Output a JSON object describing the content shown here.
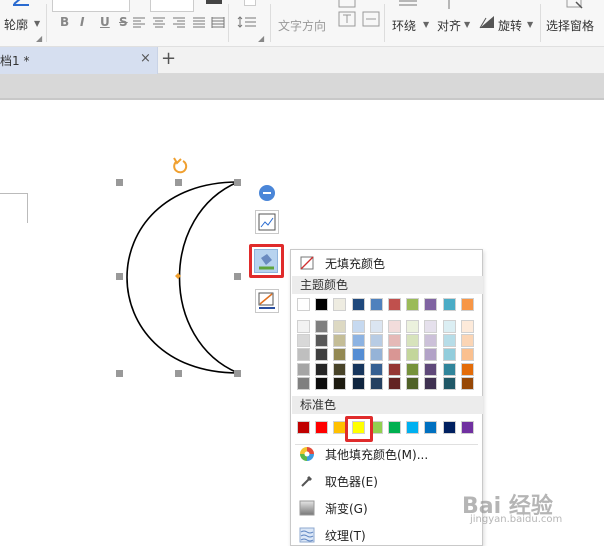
{
  "ribbon": {
    "outline_label": "轮廓",
    "text_direction_label": "文字方向",
    "wrap_label": "环绕",
    "align_label": "对齐",
    "rotate_label": "旋转",
    "selection_pane_label": "选择窗格",
    "bold": "B",
    "italic": "I",
    "underline": "U",
    "strike": "S"
  },
  "tabs": {
    "doc_tab_label": "档1 *",
    "close": "×",
    "add": "+"
  },
  "fill_menu": {
    "no_fill_label": "无填充颜色",
    "theme_colors_label": "主题颜色",
    "standard_colors_label": "标准色",
    "more_colors_label": "其他填充颜色(M)...",
    "eyedropper_label": "取色器(E)",
    "gradient_label": "渐变(G)",
    "texture_label": "纹理(T)",
    "theme_top_row": [
      "#ffffff",
      "#000000",
      "#eeece1",
      "#1f497d",
      "#4f81bd",
      "#c0504d",
      "#9bbb59",
      "#8064a2",
      "#4bacc6",
      "#f79646"
    ],
    "theme_shades": [
      [
        "#f2f2f2",
        "#7f7f7f",
        "#ddd9c3",
        "#c6d9f0",
        "#dbe5f1",
        "#f2dcdb",
        "#ebf1dd",
        "#e5e0ec",
        "#dbeef3",
        "#fdeada"
      ],
      [
        "#d8d8d8",
        "#595959",
        "#c4bd97",
        "#8db3e2",
        "#b8cce4",
        "#e5b9b7",
        "#d7e3bc",
        "#ccc1d9",
        "#b7dde8",
        "#fbd5b5"
      ],
      [
        "#bfbfbf",
        "#3f3f3f",
        "#938953",
        "#548dd4",
        "#95b3d7",
        "#d99694",
        "#c3d69b",
        "#b2a2c7",
        "#92cddc",
        "#fac08f"
      ],
      [
        "#a5a5a5",
        "#262626",
        "#494429",
        "#17365d",
        "#366092",
        "#953734",
        "#76923c",
        "#5f497a",
        "#31859b",
        "#e36c09"
      ],
      [
        "#7f7f7f",
        "#0c0c0c",
        "#1d1b10",
        "#0f243e",
        "#244061",
        "#632423",
        "#4f6128",
        "#3f3151",
        "#205867",
        "#974806"
      ]
    ],
    "standard_colors": [
      "#c00000",
      "#ff0000",
      "#ffc000",
      "#ffff00",
      "#92d050",
      "#00b050",
      "#00b0f0",
      "#0070c0",
      "#002060",
      "#7030a0"
    ],
    "highlight_color": "#e02b2b"
  },
  "watermark": {
    "brand": "Bai 经验",
    "url": "jingyan.baidu.com"
  }
}
